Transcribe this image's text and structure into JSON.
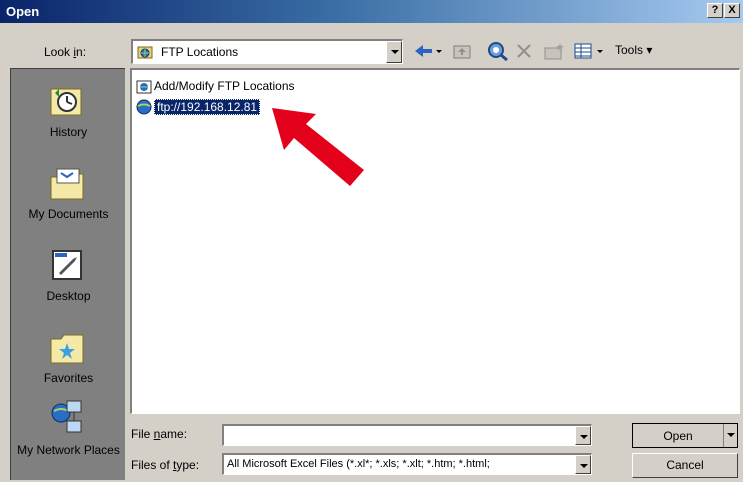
{
  "window": {
    "title": "Open",
    "help_label": "?",
    "close_label": "X"
  },
  "lookin": {
    "label": "Look in:",
    "value": "FTP Locations"
  },
  "toolbar": {
    "back_icon": "back-arrow-icon",
    "up_icon": "up-folder-icon",
    "search_web_icon": "search-web-icon",
    "delete_icon": "delete-icon",
    "new_folder_icon": "new-folder-icon",
    "views_icon": "views-icon",
    "tools_label": "Tools"
  },
  "places": [
    {
      "label": "History",
      "icon": "history-icon"
    },
    {
      "label": "My Documents",
      "icon": "my-documents-icon"
    },
    {
      "label": "Desktop",
      "icon": "desktop-icon"
    },
    {
      "label": "Favorites",
      "icon": "favorites-icon"
    },
    {
      "label": "My Network Places",
      "icon": "network-places-icon"
    }
  ],
  "files": [
    {
      "name": "Add/Modify FTP Locations",
      "selected": false
    },
    {
      "name": "ftp://192.168.12.81",
      "selected": true
    }
  ],
  "filename": {
    "label": "File name:",
    "value": ""
  },
  "filetype": {
    "label": "Files of type:",
    "value": "All Microsoft Excel Files (*.xl*; *.xls; *.xlt; *.htm; *.html;"
  },
  "buttons": {
    "open": "Open",
    "cancel": "Cancel"
  },
  "colors": {
    "accent": "#0a246a",
    "pointer": "#e3001b"
  }
}
